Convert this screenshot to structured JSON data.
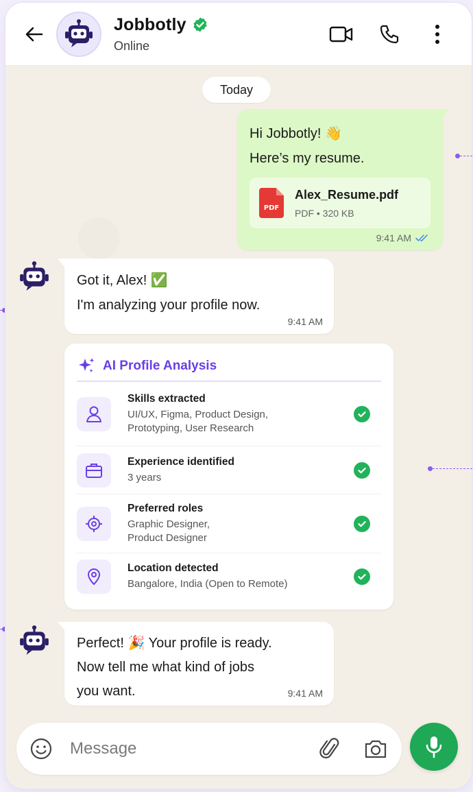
{
  "header": {
    "title": "Jobbotly",
    "status": "Online",
    "back_icon": "arrow-left-icon",
    "icons": [
      "video-call-icon",
      "phone-icon",
      "more-vertical-icon"
    ]
  },
  "date_chip": "Today",
  "messages": {
    "sent_1": {
      "line1": "Hi Jobbotly! 👋",
      "line2": "Here’s my resume.",
      "attachment": {
        "name": "Alex_Resume.pdf",
        "type_badge": "PDF",
        "meta": "PDF • 320 KB"
      },
      "time": "9:41 AM"
    },
    "recv_1": {
      "line1": "Got it, Alex! ✅",
      "line2": "I'm analyzing your profile now.",
      "time": "9:41 AM"
    },
    "analysis": {
      "title": "AI Profile Analysis",
      "rows": [
        {
          "label": "Skills extracted",
          "value_1": "UI/UX, Figma, Product Design,",
          "value_2": "Prototyping, User Research",
          "icon": "user-icon"
        },
        {
          "label": "Experience identified",
          "value_1": "3 years",
          "value_2": "",
          "icon": "briefcase-icon"
        },
        {
          "label": "Preferred roles",
          "value_1": "Graphic Designer,",
          "value_2": "Product Designer",
          "icon": "target-icon"
        },
        {
          "label": "Location detected",
          "value_1": "Bangalore, India (Open to Remote)",
          "value_2": "",
          "icon": "location-pin-icon"
        }
      ]
    },
    "recv_2": {
      "line1": "Perfect! 🎉 Your profile is ready.",
      "line2": "Now tell me what kind of jobs",
      "line3": "you want.",
      "time": "9:41 AM"
    }
  },
  "composer": {
    "placeholder": "Message",
    "icons": [
      "emoji-icon",
      "paperclip-icon",
      "camera-icon",
      "microphone-icon"
    ]
  },
  "colors": {
    "accent": "#6a3ee6",
    "sent_bubble": "#dcf8c6",
    "check_green": "#21b35a",
    "mic_green": "#1fa855",
    "chat_bg": "#f4efe6"
  }
}
